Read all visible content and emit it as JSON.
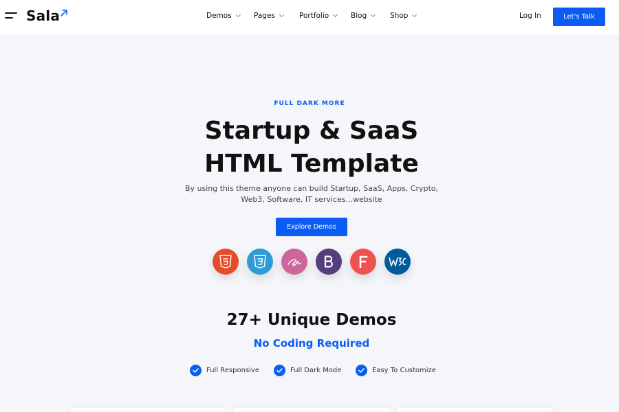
{
  "header": {
    "logo": "Sala",
    "nav": [
      {
        "label": "Demos"
      },
      {
        "label": "Pages"
      },
      {
        "label": "Portfolio"
      },
      {
        "label": "Blog"
      },
      {
        "label": "Shop"
      }
    ],
    "login_label": "Log In",
    "cta_label": "Let's Talk"
  },
  "hero": {
    "eyebrow": "FULL DARK MORE",
    "title_line1": "Startup & SaaS",
    "title_line2": "HTML Template",
    "subtitle_line1": "By using this theme anyone can build Startup, SaaS, Apps, Crypto,",
    "subtitle_line2": "Web3, Software, IT services...website",
    "cta_label": "Explore Demos",
    "tech_icons": [
      {
        "name": "html5-icon",
        "color": "#e44d26",
        "text": "HTML"
      },
      {
        "name": "css3-icon",
        "color": "#2f9bd6",
        "text": "CSS"
      },
      {
        "name": "sass-icon",
        "color": "#cd6799",
        "text": "Sass"
      },
      {
        "name": "bootstrap-icon",
        "color": "#563d7c",
        "text": "B"
      },
      {
        "name": "font-icon",
        "color": "#ef5350",
        "text": "F"
      },
      {
        "name": "w3c-icon",
        "color": "#005a9c",
        "text": "W3C"
      }
    ]
  },
  "demos": {
    "title": "27+ Unique Demos",
    "subtitle": "No Coding Required",
    "features": [
      {
        "label": "Full Responsive"
      },
      {
        "label": "Full Dark Mode"
      },
      {
        "label": "Easy To Customize"
      }
    ]
  },
  "colors": {
    "accent": "#0b5cf5",
    "background": "#f5f6fa",
    "text": "#111111"
  }
}
